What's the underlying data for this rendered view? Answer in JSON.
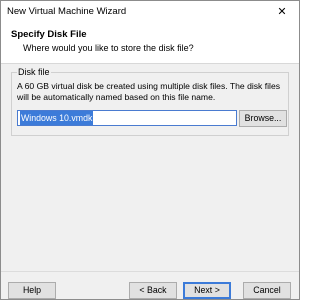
{
  "window": {
    "title": "New Virtual Machine Wizard",
    "close_glyph": "✕"
  },
  "header": {
    "title": "Specify Disk File",
    "subtitle": "Where would you like to store the disk file?"
  },
  "disk_file": {
    "group_label": "Disk file",
    "description": "A 60 GB virtual disk be created using multiple disk files. The disk files will be automatically named based on this file name.",
    "file_name": "Windows 10.vmdk",
    "browse_label": "Browse..."
  },
  "footer": {
    "help_label": "Help",
    "back_label": "< Back",
    "next_label": "Next >",
    "cancel_label": "Cancel"
  },
  "colors": {
    "selection": "#3c7bd9",
    "dialog_bg": "#f0f0f0"
  }
}
